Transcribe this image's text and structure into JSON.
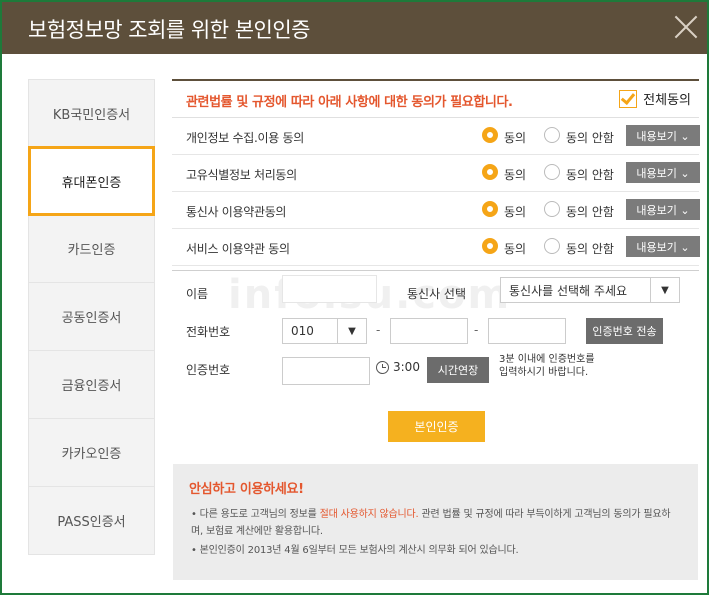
{
  "window": {
    "title": "보험정보망 조회를 위한 본인인증"
  },
  "watermark": "infoisu.com",
  "sidebar": {
    "items": [
      {
        "label": "KB국민인증서"
      },
      {
        "label": "휴대폰인증"
      },
      {
        "label": "카드인증"
      },
      {
        "label": "공동인증서"
      },
      {
        "label": "금융인증서"
      },
      {
        "label": "카카오인증"
      },
      {
        "label": "PASS인증서"
      }
    ],
    "active_index": 1
  },
  "agreement": {
    "header_msg": "관련법률 및 규정에 따라 아래 사항에 대한 동의가 필요합니다.",
    "all_agree_label": "전체동의",
    "rows": [
      {
        "label": "개인정보 수집.이용 동의",
        "agree": "동의",
        "disagree": "동의 안함",
        "view": "내용보기 ⌄"
      },
      {
        "label": "고유식별정보 처리동의",
        "agree": "동의",
        "disagree": "동의 안함",
        "view": "내용보기 ⌄"
      },
      {
        "label": "통신사 이용약관동의",
        "agree": "동의",
        "disagree": "동의 안함",
        "view": "내용보기 ⌄"
      },
      {
        "label": "서비스 이용약관 동의",
        "agree": "동의",
        "disagree": "동의 안함",
        "view": "내용보기 ⌄"
      }
    ]
  },
  "form": {
    "name_label": "이름",
    "carrier_label": "통신사 선택",
    "carrier_value": "통신사를 선택해 주세요",
    "phone_label": "전화번호",
    "phone_prefix": "010",
    "dash": "-",
    "send_btn": "인증번호 전송",
    "code_label": "인증번호",
    "timer": "3:00",
    "extend_btn": "시간연장",
    "note_line1": "3분 이내에 인증번호를",
    "note_line2": "입력하시기 바랍니다."
  },
  "submit_btn": "본인인증",
  "info": {
    "title": "안심하고 이용하세요!",
    "item1_a": "• 다른 용도로 고객님의 정보를 ",
    "item1_b": "절대 사용하지 않습니다.",
    "item1_c": " 관련 법률 및 규정에 따라 부득이하게 고객님의 동의가 필요하며, 보험료 계산에만 활용합니다.",
    "item2": "• 본인인증이 2013년 4월 6일부터 모든 보험사의 계산시 의무화 되어 있습니다."
  }
}
